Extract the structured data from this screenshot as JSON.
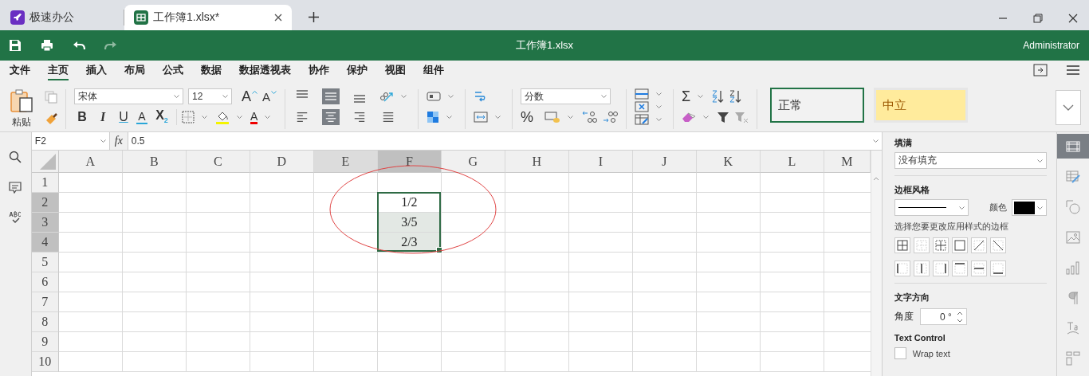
{
  "tabs": [
    {
      "label": "极速办公",
      "kind": "app",
      "selected": false
    },
    {
      "label": "工作簿1.xlsx*",
      "kind": "sheet",
      "selected": true
    }
  ],
  "title": "工作簿1.xlsx",
  "user": "Administrator",
  "menu": [
    {
      "label": "文件",
      "selected": false
    },
    {
      "label": "主页",
      "selected": true
    },
    {
      "label": "插入",
      "selected": false
    },
    {
      "label": "布局",
      "selected": false
    },
    {
      "label": "公式",
      "selected": false
    },
    {
      "label": "数据",
      "selected": false
    },
    {
      "label": "数据透视表",
      "selected": false
    },
    {
      "label": "协作",
      "selected": false
    },
    {
      "label": "保护",
      "selected": false
    },
    {
      "label": "视图",
      "selected": false
    },
    {
      "label": "组件",
      "selected": false
    }
  ],
  "ribbon": {
    "paste": "粘贴",
    "font": "宋体",
    "size": "12",
    "grow": "A",
    "shrink": "A",
    "font_buttons": [
      {
        "kind": "bold",
        "label": "B"
      },
      {
        "kind": "italic",
        "label": "I"
      },
      {
        "kind": "underline",
        "label": "U"
      },
      {
        "kind": "strike",
        "label": "A"
      },
      {
        "kind": "subscript",
        "label": "X$_{2}$"
      }
    ],
    "font_color": "A",
    "vertical_align": [
      {
        "kind": "top",
        "selected": false
      },
      {
        "kind": "middle",
        "selected": true
      },
      {
        "kind": "bottom",
        "selected": false
      }
    ],
    "horizontal_align": [
      {
        "kind": "left",
        "selected": false
      },
      {
        "kind": "center",
        "selected": true
      },
      {
        "kind": "right",
        "selected": false
      },
      {
        "kind": "justify",
        "selected": false
      }
    ],
    "number_format": "分数",
    "percent": "%",
    "sum": "Σ",
    "styles": [
      {
        "label": "正常",
        "kind": "normal"
      },
      {
        "label": "中立",
        "kind": "neutral"
      }
    ]
  },
  "formula": {
    "cell": "F2",
    "fx": "fx",
    "value": "0.5"
  },
  "sheet": {
    "columns": [
      {
        "label": "A",
        "selected": false,
        "hovered": false
      },
      {
        "label": "B",
        "selected": false,
        "hovered": false
      },
      {
        "label": "C",
        "selected": false,
        "hovered": false
      },
      {
        "label": "D",
        "selected": false,
        "hovered": false
      },
      {
        "label": "E",
        "selected": false,
        "hovered": true
      },
      {
        "label": "F",
        "selected": true,
        "hovered": false
      },
      {
        "label": "G",
        "selected": false,
        "hovered": false
      },
      {
        "label": "H",
        "selected": false,
        "hovered": false
      },
      {
        "label": "I",
        "selected": false,
        "hovered": false
      },
      {
        "label": "J",
        "selected": false,
        "hovered": false
      },
      {
        "label": "K",
        "selected": false,
        "hovered": false
      },
      {
        "label": "L",
        "selected": false,
        "hovered": false
      },
      {
        "label": "M",
        "selected": false,
        "hovered": false
      }
    ],
    "rows": [
      {
        "label": "1",
        "selected": false,
        "cells": [
          null,
          null,
          null,
          null,
          null,
          null,
          null,
          null,
          null,
          null,
          null,
          null,
          null
        ]
      },
      {
        "label": "2",
        "selected": true,
        "cells": [
          null,
          null,
          null,
          null,
          null,
          {
            "value": "1/2",
            "active": true,
            "selected": true
          },
          null,
          null,
          null,
          null,
          null,
          null,
          null
        ]
      },
      {
        "label": "3",
        "selected": true,
        "cells": [
          null,
          null,
          null,
          null,
          null,
          {
            "value": "3/5",
            "active": false,
            "selected": true
          },
          null,
          null,
          null,
          null,
          null,
          null,
          null
        ]
      },
      {
        "label": "4",
        "selected": true,
        "cells": [
          null,
          null,
          null,
          null,
          null,
          {
            "value": "2/3",
            "active": false,
            "selected": true
          },
          null,
          null,
          null,
          null,
          null,
          null,
          null
        ]
      },
      {
        "label": "5",
        "selected": false,
        "cells": [
          null,
          null,
          null,
          null,
          null,
          null,
          null,
          null,
          null,
          null,
          null,
          null,
          null
        ]
      },
      {
        "label": "6",
        "selected": false,
        "cells": [
          null,
          null,
          null,
          null,
          null,
          null,
          null,
          null,
          null,
          null,
          null,
          null,
          null
        ]
      },
      {
        "label": "7",
        "selected": false,
        "cells": [
          null,
          null,
          null,
          null,
          null,
          null,
          null,
          null,
          null,
          null,
          null,
          null,
          null
        ]
      },
      {
        "label": "8",
        "selected": false,
        "cells": [
          null,
          null,
          null,
          null,
          null,
          null,
          null,
          null,
          null,
          null,
          null,
          null,
          null
        ]
      },
      {
        "label": "9",
        "selected": false,
        "cells": [
          null,
          null,
          null,
          null,
          null,
          null,
          null,
          null,
          null,
          null,
          null,
          null,
          null
        ]
      },
      {
        "label": "10",
        "selected": false,
        "cells": [
          null,
          null,
          null,
          null,
          null,
          null,
          null,
          null,
          null,
          null,
          null,
          null,
          null
        ]
      }
    ]
  },
  "panel": {
    "fill_label": "填满",
    "fill_value": "没有填充",
    "border_label": "边框风格",
    "color_label": "颜色",
    "border_hint": "选择您要更改应用样式的边框",
    "direction_label": "文字方向",
    "angle_label": "角度",
    "angle_value": "0 °",
    "control_label": "Text Control",
    "wrap": {
      "label": "Wrap text",
      "checked": false
    }
  },
  "side_tabs": [
    {
      "kind": "cell",
      "selected": true
    },
    {
      "kind": "table",
      "selected": false
    },
    {
      "kind": "shape",
      "selected": false
    },
    {
      "kind": "image",
      "selected": false
    },
    {
      "kind": "chart",
      "selected": false
    },
    {
      "kind": "paragraph",
      "selected": false
    },
    {
      "kind": "textart",
      "selected": false
    },
    {
      "kind": "pivot",
      "selected": false
    }
  ]
}
